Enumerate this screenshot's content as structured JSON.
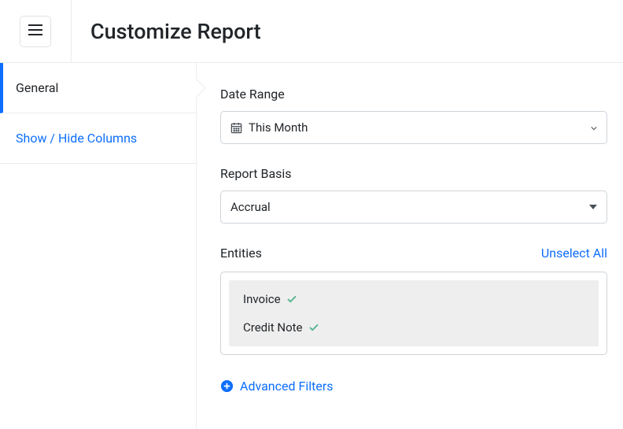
{
  "header": {
    "title": "Customize Report"
  },
  "sidebar": {
    "items": [
      {
        "label": "General",
        "active": true
      },
      {
        "label": "Show / Hide Columns",
        "active": false
      }
    ]
  },
  "main": {
    "date_range": {
      "label": "Date Range",
      "value": "This Month"
    },
    "report_basis": {
      "label": "Report Basis",
      "value": "Accrual"
    },
    "entities": {
      "label": "Entities",
      "unselect_label": "Unselect All",
      "items": [
        {
          "label": "Invoice",
          "checked": true
        },
        {
          "label": "Credit Note",
          "checked": true
        }
      ]
    },
    "advanced_filters_label": "Advanced Filters"
  }
}
